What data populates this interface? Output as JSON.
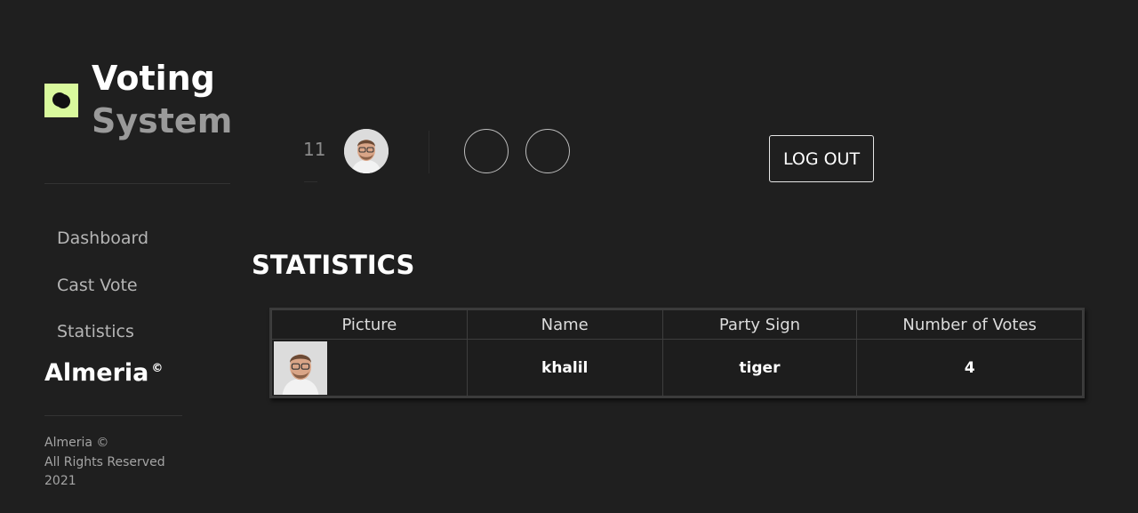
{
  "brand": {
    "title_line1": "Voting",
    "title_line2": "System",
    "accent_color": "#d9f99d",
    "logo_icon": "circle-logo-icon"
  },
  "sidebar": {
    "items": [
      {
        "label": "Dashboard"
      },
      {
        "label": "Cast Vote"
      },
      {
        "label": "Statistics"
      }
    ],
    "company": "Almeria",
    "company_mark": "©",
    "footer": {
      "line1": "Almeria ©",
      "line2": "All Rights Reserved",
      "line3": "2021"
    }
  },
  "header": {
    "count": "11",
    "logout_label": "LOG OUT"
  },
  "main": {
    "heading": "STATISTICS",
    "table": {
      "columns": [
        "Picture",
        "Name",
        "Party Sign",
        "Number of Votes"
      ],
      "rows": [
        {
          "name": "khalil",
          "party_sign": "tiger",
          "votes": "4"
        }
      ]
    }
  }
}
